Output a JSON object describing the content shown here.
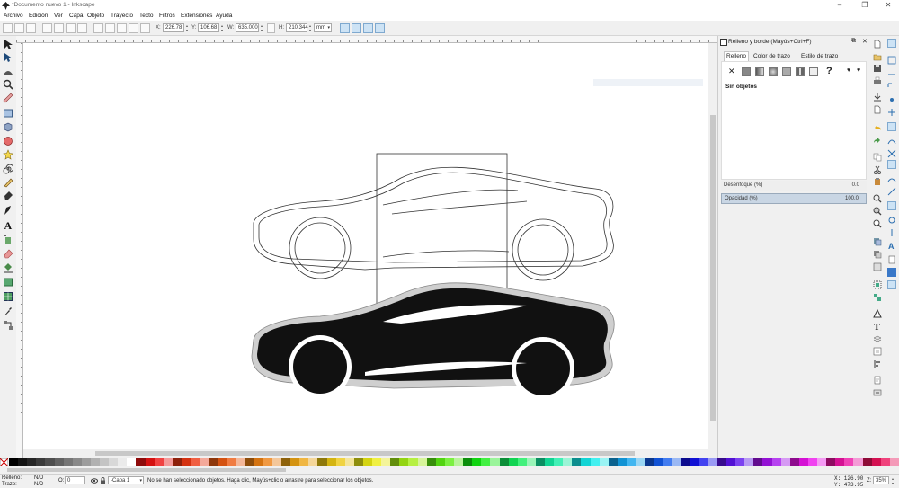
{
  "window": {
    "title": "*Documento nuevo 1 - Inkscape",
    "min": "–",
    "max": "❐",
    "close": "✕"
  },
  "menu": [
    "Archivo",
    "Edición",
    "Ver",
    "Capa",
    "Objeto",
    "Trayecto",
    "Texto",
    "Filtros",
    "Extensiones",
    "Ayuda"
  ],
  "toolbar": {
    "x_label": "X:",
    "x_value": "226.78",
    "y_label": "Y:",
    "y_value": "106.68",
    "w_label": "W:",
    "w_value": "635.000",
    "h_label": "H:",
    "h_value": "210.344",
    "unit": "mm"
  },
  "dock": {
    "title": "Relleno y borde (Mayús+Ctrl+F)",
    "tabs": [
      "Relleno",
      "Color de trazo",
      "Estilo de trazo"
    ],
    "no_objects": "Sin objetos",
    "blur_label": "Desenfoque (%)",
    "blur_value": "0.0",
    "opacity_label": "Opacidad (%)",
    "opacity_value": "100.0"
  },
  "status": {
    "fill_label": "Relleno:",
    "fill_value": "N/D",
    "stroke_label": "Trazo:",
    "stroke_value": "N/D",
    "o_label": "O:",
    "o_value": "0",
    "layer": "-Capa 1",
    "message": "No se han seleccionado objetos. Haga clic, Mayús+clic o arrastre para seleccionar los objetos.",
    "x_coord": "X: 126.90",
    "y_coord": "Y: 473.95",
    "zoom_label": "Z:",
    "zoom_value": "35%"
  },
  "colors": {
    "accent": "#cde3f5",
    "canvas": "#ffffff",
    "car_fill": "#111111"
  }
}
